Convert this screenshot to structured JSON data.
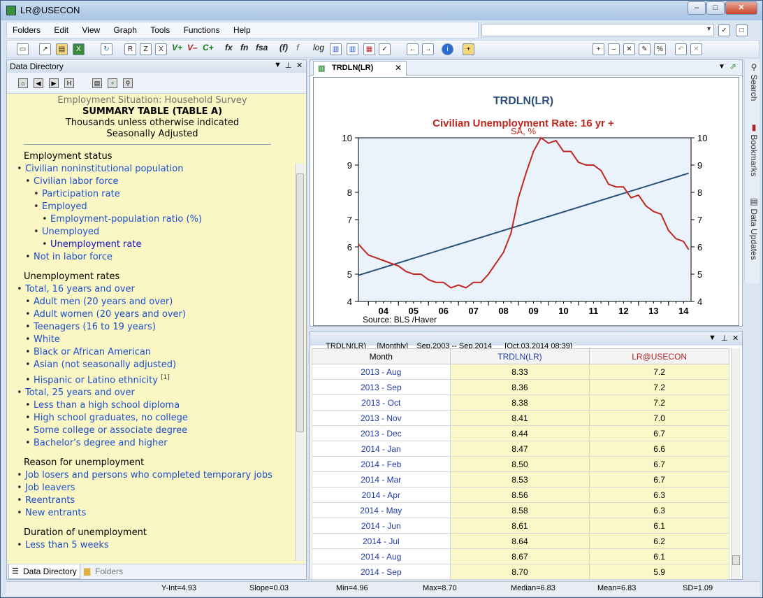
{
  "app_title": "LR@USECON",
  "menu": [
    "Folders",
    "Edit",
    "View",
    "Graph",
    "Tools",
    "Functions",
    "Help"
  ],
  "toolbar": {
    "labels": [
      "R",
      "Z",
      "X",
      "V+",
      "V–",
      "C+",
      "fx",
      "fn",
      "fsa",
      "(f)",
      "f",
      "log"
    ]
  },
  "left_panel": {
    "title": "Data Directory",
    "header": {
      "line1": "Employment Situation: Household Survey",
      "line2": "SUMMARY TABLE (TABLE A)",
      "line3": "Thousands unless otherwise indicated",
      "line4": "Seasonally Adjusted"
    },
    "sections": {
      "employment_status": "Employment status",
      "unemployment_rates": "Unemployment rates",
      "reason": "Reason for unemployment",
      "duration": "Duration of unemployment"
    },
    "items": {
      "civ_noninst": "Civilian noninstitutional population",
      "civ_labor": "Civilian labor force",
      "participation": "Participation rate",
      "employed": "Employed",
      "emp_pop_ratio": "Employment-population ratio (%)",
      "unemployed": "Unemployed",
      "unemp_rate": "Unemployment rate",
      "not_in_lf": "Not in labor force",
      "total16": "Total, 16 years and over",
      "adult_men": "Adult men (20 years and over)",
      "adult_women": "Adult women (20 years and over)",
      "teenagers": "Teenagers (16 to 19 years)",
      "white": "White",
      "black": "Black or African American",
      "asian": "Asian (not seasonally adjusted)",
      "hispanic": "Hispanic or Latino ethnicity",
      "hispanic_note": "[1]",
      "total25": "Total, 25 years and over",
      "less_hs": "Less than a high school diploma",
      "hs_grad": "High school graduates, no college",
      "some_college": "Some college or associate degree",
      "bachelor": "Bachelor's degree and higher",
      "job_losers": "Job losers and persons who completed temporary jobs",
      "job_leavers": "Job leavers",
      "reentrants": "Reentrants",
      "new_entrants": "New entrants",
      "less5weeks": "Less than 5 weeks"
    },
    "tabs": {
      "dir": "Data Directory",
      "folders": "Folders"
    }
  },
  "graph_panel": {
    "tab": "TRDLN(LR)",
    "close": "✕"
  },
  "chart_data": {
    "type": "line",
    "title": "TRDLN(LR)",
    "subtitle": "Civilian Unemployment Rate: 16 yr +",
    "subtitle2": "SA, %",
    "source": "Source:  BLS /Haver",
    "xtick_labels": [
      "04",
      "05",
      "06",
      "07",
      "08",
      "09",
      "10",
      "11",
      "12",
      "13",
      "14"
    ],
    "yticks": [
      4,
      5,
      6,
      7,
      8,
      9,
      10
    ],
    "ylim": [
      4,
      10
    ],
    "xlim": [
      2003.667,
      2014.75
    ],
    "grid": false,
    "series": [
      {
        "values": [
          [
            2003.67,
            6.1
          ],
          [
            2003.83,
            5.9
          ],
          [
            2004.0,
            5.7
          ],
          [
            2004.25,
            5.6
          ],
          [
            2004.5,
            5.5
          ],
          [
            2004.75,
            5.4
          ],
          [
            2005.0,
            5.3
          ],
          [
            2005.25,
            5.1
          ],
          [
            2005.5,
            5.0
          ],
          [
            2005.75,
            5.0
          ],
          [
            2006.0,
            4.8
          ],
          [
            2006.25,
            4.7
          ],
          [
            2006.5,
            4.7
          ],
          [
            2006.75,
            4.5
          ],
          [
            2007.0,
            4.6
          ],
          [
            2007.25,
            4.5
          ],
          [
            2007.5,
            4.7
          ],
          [
            2007.75,
            4.7
          ],
          [
            2008.0,
            5.0
          ],
          [
            2008.25,
            5.4
          ],
          [
            2008.5,
            5.8
          ],
          [
            2008.75,
            6.5
          ],
          [
            2009.0,
            7.8
          ],
          [
            2009.25,
            8.7
          ],
          [
            2009.5,
            9.5
          ],
          [
            2009.75,
            10.0
          ],
          [
            2010.0,
            9.8
          ],
          [
            2010.25,
            9.9
          ],
          [
            2010.5,
            9.5
          ],
          [
            2010.75,
            9.5
          ],
          [
            2011.0,
            9.1
          ],
          [
            2011.25,
            9.0
          ],
          [
            2011.5,
            9.0
          ],
          [
            2011.75,
            8.8
          ],
          [
            2012.0,
            8.3
          ],
          [
            2012.25,
            8.2
          ],
          [
            2012.5,
            8.2
          ],
          [
            2012.75,
            7.8
          ],
          [
            2013.0,
            7.9
          ],
          [
            2013.25,
            7.5
          ],
          [
            2013.5,
            7.3
          ],
          [
            2013.75,
            7.2
          ],
          [
            2014.0,
            6.6
          ],
          [
            2014.25,
            6.3
          ],
          [
            2014.5,
            6.2
          ],
          [
            2014.67,
            5.9
          ]
        ]
      },
      {
        "values": [
          [
            2003.67,
            4.96
          ],
          [
            2014.67,
            8.7
          ]
        ]
      }
    ]
  },
  "table_panel": {
    "header": "TRDLN(LR)     [Monthly]    Sep.2003 -- Sep.2014      [Oct.03.2014 08:39]",
    "columns": [
      "Month",
      "TRDLN(LR)",
      "LR@USECON"
    ],
    "rows": [
      [
        "2013 - Aug",
        "8.33",
        "7.2"
      ],
      [
        "2013 - Sep",
        "8.36",
        "7.2"
      ],
      [
        "2013 - Oct",
        "8.38",
        "7.2"
      ],
      [
        "2013 - Nov",
        "8.41",
        "7.0"
      ],
      [
        "2013 - Dec",
        "8.44",
        "6.7"
      ],
      [
        "2014 - Jan",
        "8.47",
        "6.6"
      ],
      [
        "2014 - Feb",
        "8.50",
        "6.7"
      ],
      [
        "2014 - Mar",
        "8.53",
        "6.7"
      ],
      [
        "2014 - Apr",
        "8.56",
        "6.3"
      ],
      [
        "2014 - May",
        "8.58",
        "6.3"
      ],
      [
        "2014 - Jun",
        "8.61",
        "6.1"
      ],
      [
        "2014 - Jul",
        "8.64",
        "6.2"
      ],
      [
        "2014 - Aug",
        "8.67",
        "6.1"
      ],
      [
        "2014 - Sep",
        "8.70",
        "5.9"
      ]
    ]
  },
  "side_tabs": [
    "Search",
    "Bookmarks",
    "Data Updates"
  ],
  "status": {
    "yint": "Y-Int=4.93",
    "slope": "Slope=0.03",
    "min": "Min=4.96",
    "max": "Max=8.70",
    "median": "Median=6.83",
    "mean": "Mean=6.83",
    "sd": "SD=1.09"
  },
  "colors": {
    "rate": "#c0281e",
    "trend": "#2a4f7a",
    "panel_bg": "#fbf7c4",
    "link": "#1a4fcf"
  }
}
